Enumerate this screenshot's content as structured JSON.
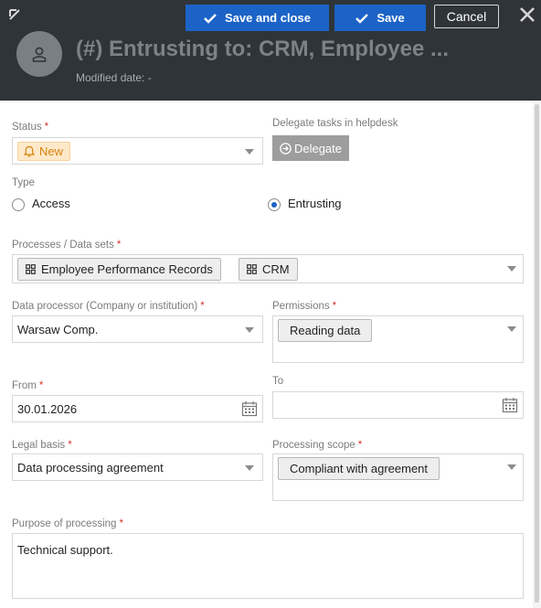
{
  "header": {
    "title": "(#) Entrusting to: CRM, Employee ...",
    "modified_label": "Modified date: -",
    "save_close_label": "Save and close",
    "save_label": "Save",
    "cancel_label": "Cancel"
  },
  "form": {
    "status": {
      "label": "Status",
      "value": "New"
    },
    "delegate": {
      "label": "Delegate tasks in helpdesk",
      "button_label": "Delegate"
    },
    "type": {
      "label": "Type",
      "options": [
        "Access",
        "Entrusting"
      ],
      "selected": "Entrusting"
    },
    "processes": {
      "label": "Processes / Data sets",
      "chips": [
        "Employee Performance Records",
        "CRM"
      ]
    },
    "data_processor": {
      "label": "Data processor (Company or institution)",
      "value": "Warsaw Comp."
    },
    "permissions": {
      "label": "Permissions",
      "chips": [
        "Reading data"
      ]
    },
    "from": {
      "label": "From",
      "value": "30.01.2026"
    },
    "to": {
      "label": "To",
      "value": ""
    },
    "legal_basis": {
      "label": "Legal basis",
      "value": "Data processing agreement"
    },
    "processing_scope": {
      "label": "Processing scope",
      "chips": [
        "Compliant with agreement"
      ]
    },
    "purpose": {
      "label": "Purpose of processing",
      "value": "Technical support."
    },
    "required_mark": "*"
  },
  "icons": [
    "expand-icon",
    "check-icon",
    "close-icon",
    "user-icon",
    "bell-icon",
    "arrow-circle-right-icon",
    "grid-icon",
    "calendar-icon",
    "chevron-down-icon"
  ],
  "colors": {
    "header_bg": "#2f3439",
    "primary_button": "#1b63c6",
    "required": "#d9332f",
    "status_new_bg": "#fde9c9",
    "status_new_text": "#d7830f",
    "delegate_button": "#9d9d9d"
  }
}
